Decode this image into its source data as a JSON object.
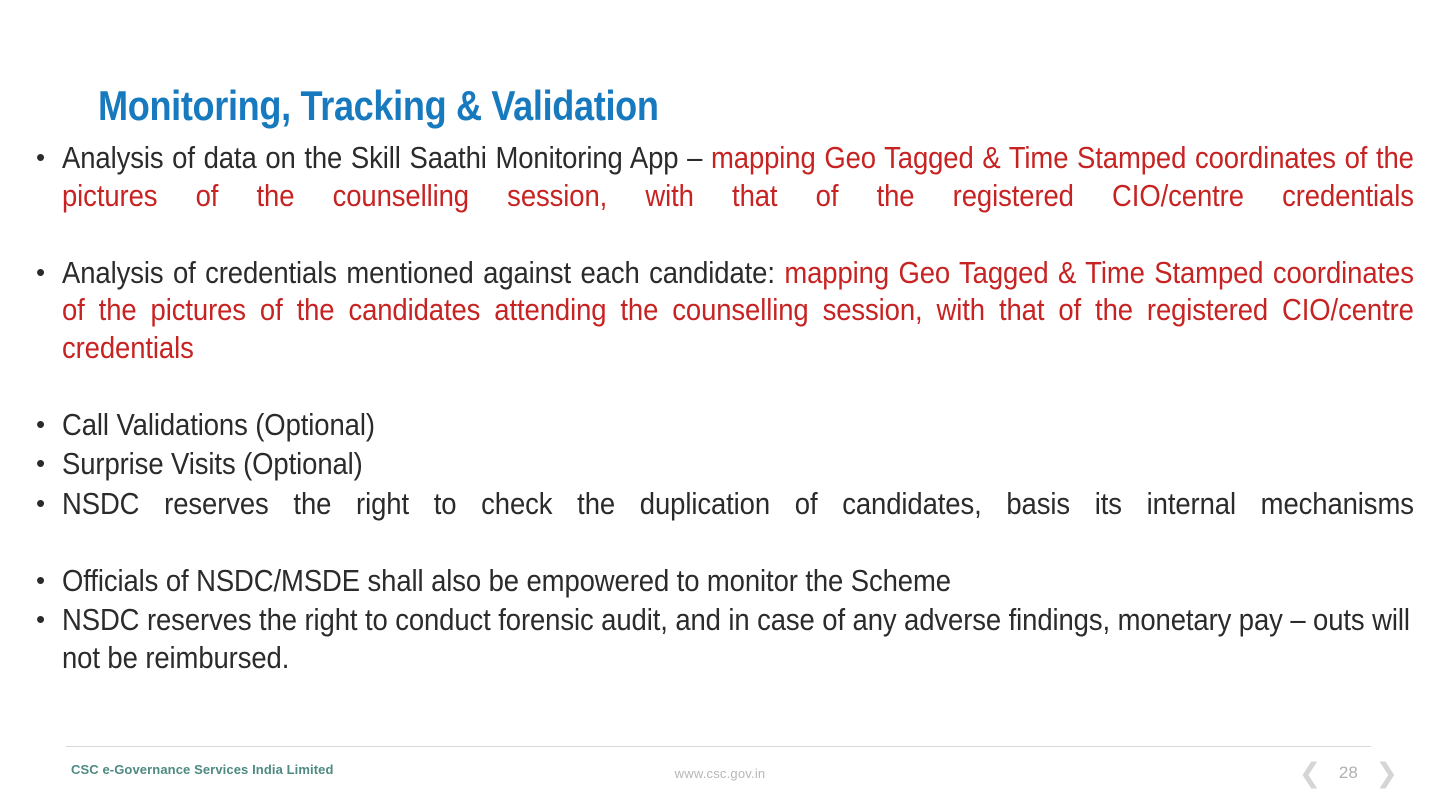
{
  "slide": {
    "title": "Monitoring, Tracking & Validation",
    "title_color": "#1779BE",
    "body_color": "#2b2b2b",
    "highlight_color": "#C72323",
    "background": "#ffffff"
  },
  "bullets": [
    {
      "segments": [
        {
          "text": "Analysis of data on the Skill Saathi Monitoring App – ",
          "color": "black"
        },
        {
          "text": "mapping Geo Tagged & Time Stamped coordinates of the pictures of the counselling session, with that of the registered CIO/centre credentials",
          "color": "red"
        }
      ],
      "justified": true
    },
    {
      "segments": [
        {
          "text": "Analysis of credentials mentioned against each candidate: ",
          "color": "black"
        },
        {
          "text": "mapping Geo Tagged & Time Stamped coordinates of the pictures of the candidates attending the counselling session, with that of the registered CIO/centre credentials",
          "color": "red"
        }
      ],
      "justified": true
    },
    {
      "segments": [
        {
          "text": "Call Validations (Optional)",
          "color": "black"
        }
      ],
      "justified": false
    },
    {
      "segments": [
        {
          "text": "Surprise Visits (Optional)",
          "color": "black"
        }
      ],
      "justified": false
    },
    {
      "segments": [
        {
          "text": "NSDC reserves the right to check the duplication of candidates, basis its internal mechanisms",
          "color": "black"
        }
      ],
      "justified": true
    },
    {
      "segments": [
        {
          "text": "Officials of  NSDC/MSDE shall also be empowered to monitor the Scheme",
          "color": "black"
        }
      ],
      "justified": false
    },
    {
      "segments": [
        {
          "text": "NSDC reserves the right to conduct forensic audit, and in case of any adverse findings, monetary pay – outs will not be reimbursed.",
          "color": "black"
        }
      ],
      "justified": true
    }
  ],
  "footer": {
    "organization": "CSC e-Governance Services India Limited",
    "website": "www.csc.gov.in",
    "page_number": "28",
    "prev_icon": "❮",
    "next_icon": "❯"
  }
}
